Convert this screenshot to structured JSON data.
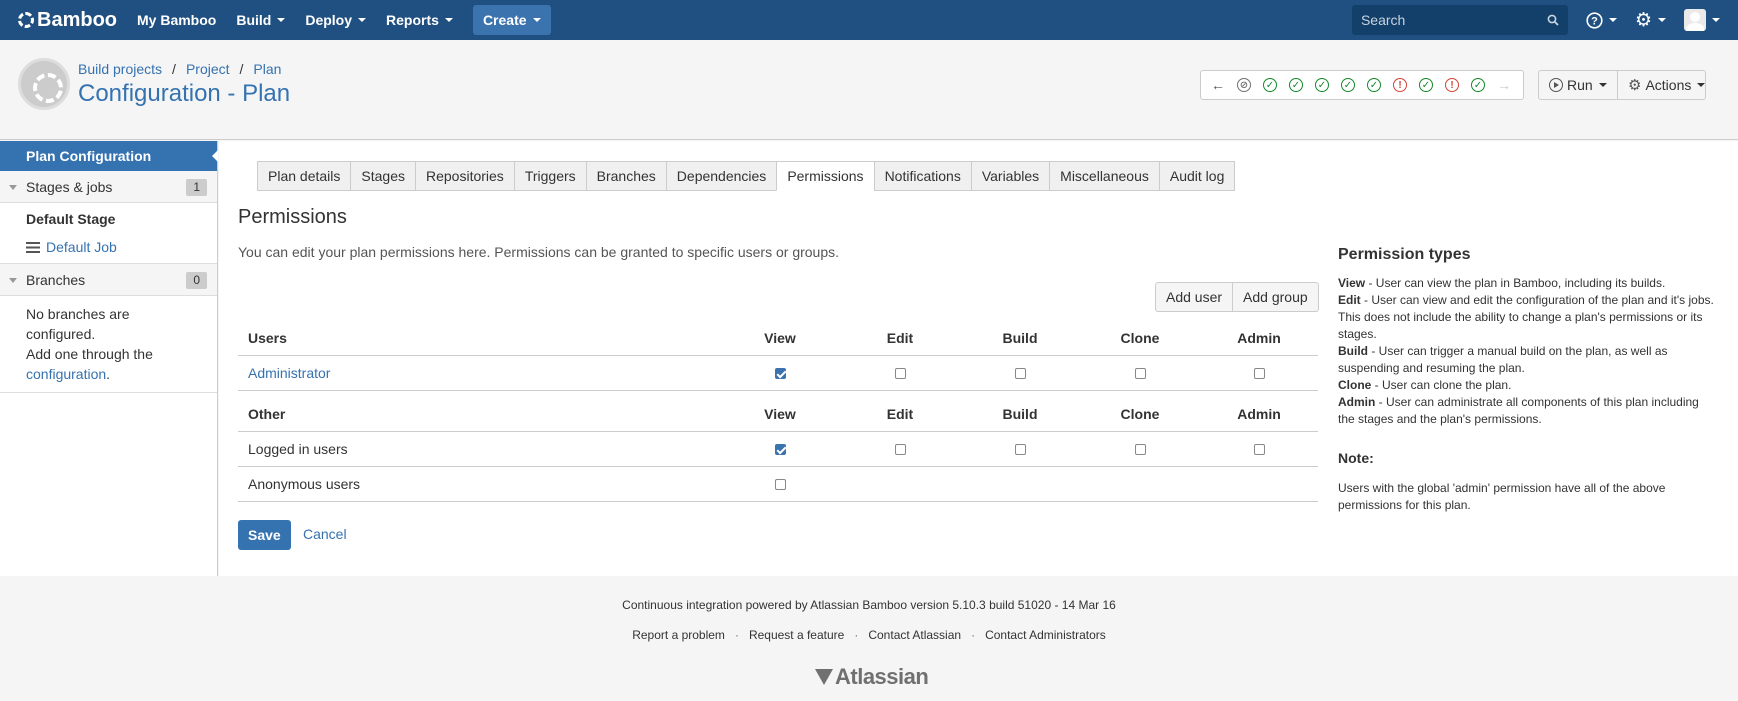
{
  "topbar": {
    "logo": "Bamboo",
    "nav": [
      "My Bamboo",
      "Build",
      "Deploy",
      "Reports"
    ],
    "create": "Create",
    "search_placeholder": "Search",
    "help_icon": "?",
    "gear_icon": "⚙"
  },
  "header": {
    "breadcrumb": [
      "Build projects",
      "Project",
      "Plan"
    ],
    "title": "Configuration - Plan",
    "run": "Run",
    "actions": "Actions",
    "statuses": [
      "disabled",
      "ok",
      "ok",
      "ok",
      "ok",
      "ok",
      "fail",
      "ok",
      "fail",
      "ok"
    ]
  },
  "sidebar": {
    "active": "Plan Configuration",
    "stages_label": "Stages & jobs",
    "stages_count": "1",
    "default_stage": "Default Stage",
    "default_job": "Default Job",
    "branches_label": "Branches",
    "branches_count": "0",
    "branches_note_1": "No branches are configured.",
    "branches_note_2": "Add one through the",
    "branches_link": "configuration",
    "branches_period": "."
  },
  "tabs": [
    "Plan details",
    "Stages",
    "Repositories",
    "Triggers",
    "Branches",
    "Dependencies",
    "Permissions",
    "Notifications",
    "Variables",
    "Miscellaneous",
    "Audit log"
  ],
  "main": {
    "title": "Permissions",
    "description": "You can edit your plan permissions here. Permissions can be granted to specific users or groups.",
    "add_user": "Add user",
    "add_group": "Add group",
    "columns": [
      "View",
      "Edit",
      "Build",
      "Clone",
      "Admin"
    ],
    "users_header": "Users",
    "other_header": "Other",
    "users": [
      {
        "name": "Administrator",
        "perms": [
          true,
          false,
          false,
          false,
          false
        ]
      }
    ],
    "other": [
      {
        "name": "Logged in users",
        "perms": [
          true,
          false,
          false,
          false,
          false
        ]
      },
      {
        "name": "Anonymous users",
        "perms": [
          false
        ]
      }
    ],
    "save": "Save",
    "cancel": "Cancel"
  },
  "help": {
    "title": "Permission types",
    "items": [
      {
        "term": "View",
        "desc": " - User can view the plan in Bamboo, including its builds."
      },
      {
        "term": "Edit",
        "desc": " - User can view and edit the configuration of the plan and it's jobs. This does not include the ability to change a plan's permissions or its stages."
      },
      {
        "term": "Build",
        "desc": " - User can trigger a manual build on the plan, as well as suspending and resuming the plan."
      },
      {
        "term": "Clone",
        "desc": " - User can clone the plan."
      },
      {
        "term": "Admin",
        "desc": " - User can administrate all components of this plan including the stages and the plan's permissions."
      }
    ],
    "note_title": "Note:",
    "note_text": "Users with the global 'admin' permission have all of the above permissions for this plan."
  },
  "footer": {
    "powered": "Continuous integration powered by Atlassian Bamboo version 5.10.3 build 51020 - 14 Mar 16",
    "links": [
      "Report a problem",
      "Request a feature",
      "Contact Atlassian",
      "Contact Administrators"
    ],
    "brand": "Atlassian"
  }
}
